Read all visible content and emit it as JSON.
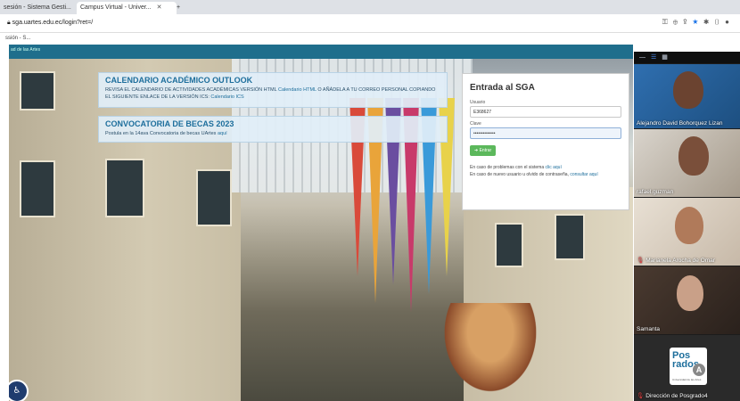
{
  "browser": {
    "tabs": [
      {
        "label": "sesión - Sistema Gesti..."
      },
      {
        "label": "Campus Virtual - Univer..."
      }
    ],
    "url": "sga.uartes.edu.ec/login?ret=/",
    "bookmark": "ssión - S..."
  },
  "site": {
    "brand": "ad de las Artes"
  },
  "calendar": {
    "title": "CALENDARIO ACADÉMICO OUTLOOK",
    "text_before": "REVISA EL CALENDARIO DE ACTIVIDADES ACADÉMICAS VERSIÓN HTML",
    "link_html": "Calendario HTML",
    "text_middle": " O AÑÁDELA A TU CORREO PERSONAL COPIANDO EL SIGUIENTE ENLACE DE LA VERSIÓN ICS: ",
    "link_ics": "Calendario ICS"
  },
  "becas": {
    "title": "CONVOCATORIA DE BECAS 2023",
    "text": "Postula en la 14ava Convocatoria de becas UArtes ",
    "link": "aquí"
  },
  "login": {
    "title": "Entrada al SGA",
    "user_label": "Usuario",
    "user_value": "E368627",
    "pass_label": "Clave",
    "pass_value": "••••••••••••••",
    "enter_label": "Entrar",
    "help1_text": "En caso de problemas con el sistema ",
    "help1_link": "clic aquí",
    "help2_text": "En caso de nuevo usuario u olvido de contraseña, ",
    "help2_link": "consultar aquí"
  },
  "meeting": {
    "toolbar_icons": [
      "minimize-icon",
      "tiles-icon",
      "grid-icon"
    ],
    "participants": [
      {
        "name": "Alejandro David Bohorquez Lizan",
        "muted": false
      },
      {
        "name": "rafael.guzman",
        "muted": false
      },
      {
        "name": "Marianela Arocha de Omar",
        "muted": true
      },
      {
        "name": "Samanta",
        "muted": false
      },
      {
        "name": "Dirección de Posgrado4",
        "muted": true
      }
    ],
    "logo_text": "Pos\nrados",
    "logo_letter": "A",
    "logo_sub": "Universidad de las Artes"
  },
  "colors": {
    "brand": "#1d6e9c",
    "topbar": "#1f6e8c",
    "success": "#5cb85c",
    "muted_mic": "#e04040"
  }
}
